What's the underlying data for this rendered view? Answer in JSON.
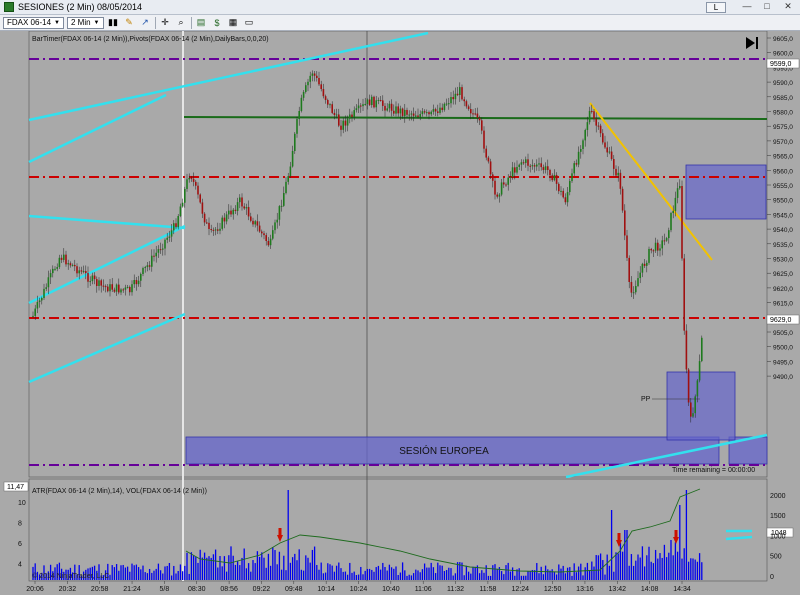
{
  "window": {
    "title": "SESIONES (2 Min)  08/05/2014",
    "l_button": "L",
    "minimize": "—",
    "maximize": "□",
    "close": "✕"
  },
  "toolbar": {
    "instrument": "FDAX 06-14",
    "interval": "2 Min"
  },
  "chart": {
    "indicator_label": "BarTimer(FDAX 06-14 (2 Min)),Pivots(FDAX 06-14 (2 Min),DailyBars,0,0,20)",
    "session_label": "SESIÓN EUROPEA",
    "pp_label": "PP",
    "time_remaining": "Time remaining = 00:00:00",
    "price_axis": [
      "9605,0",
      "9600,0",
      "9595,0",
      "9590,0",
      "9585,0",
      "9580,0",
      "9575,0",
      "9570,0",
      "9565,0",
      "9560,0",
      "9555,0",
      "9550,0",
      "9545,0",
      "9540,0",
      "9535,0",
      "9530,0",
      "9625,0",
      "9620,0",
      "9615,0",
      "9510,0",
      "9505,0",
      "9500,0",
      "9495,0",
      "9490,0"
    ],
    "price_marker_top": "9599,0",
    "price_marker_last": "9629,0",
    "colors": {
      "background": "#a9a9a9",
      "pivot_red": "#cc0000",
      "pivot_purple": "#660099",
      "trend_cyan": "#33e0ee",
      "trend_yellow": "#f2c200",
      "green_line": "#1a6b1a",
      "zone_fill": "#6666cc"
    }
  },
  "lower_panel": {
    "label": "ATR(FDAX 06-14 (2 Min),14), VOL(FDAX 06-14 (2 Min))",
    "atr_marker": "11,47",
    "vol_marker": "1048",
    "left_ticks": [
      "10",
      "8",
      "6",
      "4"
    ],
    "right_ticks": [
      "2000",
      "1500",
      "1000",
      "500",
      "0"
    ],
    "copyright": "© 2014 NinjaTrader, LLC"
  },
  "time_axis": [
    "20:06",
    "20:32",
    "20:58",
    "21:24",
    "5/8",
    "08:30",
    "08:56",
    "09:22",
    "09:48",
    "10:14",
    "10:24",
    "10:40",
    "11:06",
    "11:32",
    "11:58",
    "12:24",
    "12:50",
    "13:16",
    "13:42",
    "14:08",
    "14:34"
  ]
}
